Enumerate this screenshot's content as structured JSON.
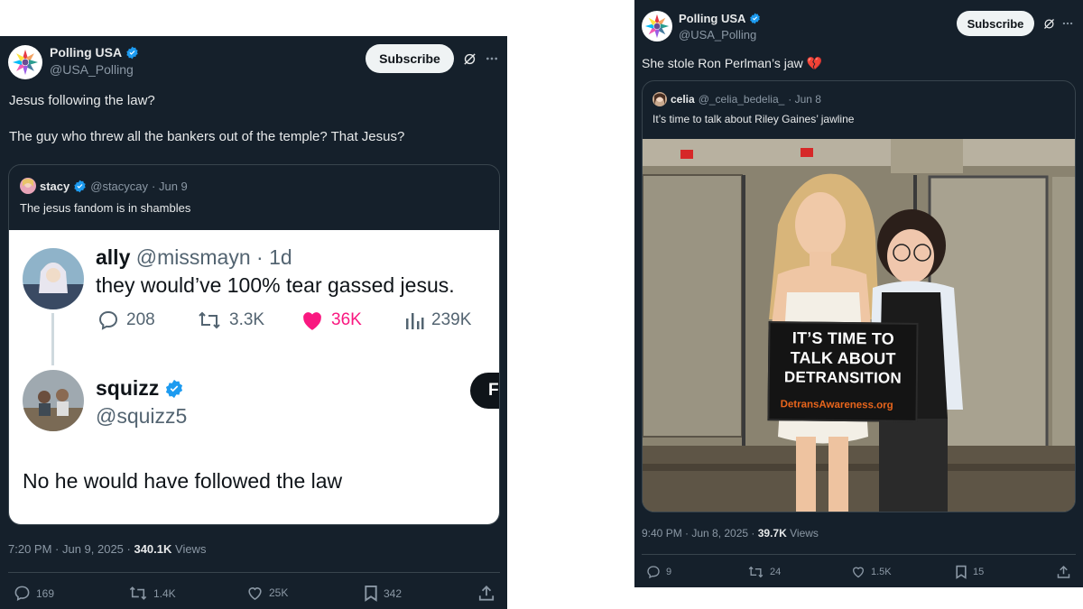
{
  "left_post": {
    "author": {
      "name": "Polling USA",
      "handle": "@USA_Polling"
    },
    "subscribe_label": "Subscribe",
    "text": "Jesus following the law?\n\nThe guy who threw all the bankers out of the temple? That Jesus?",
    "quote": {
      "name": "stacy",
      "handle": "@stacycay",
      "date": "· Jun 9",
      "text": "The jesus fandom is in shambles",
      "screenshot": {
        "first": {
          "name": "ally",
          "handle": "@missmayn",
          "age": "· 1d",
          "text": "they would’ve 100% tear gassed jesus.",
          "stats": {
            "replies": "208",
            "reposts": "3.3K",
            "likes": "36K",
            "views": "239K"
          }
        },
        "second": {
          "name": "squizz",
          "handle": "@squizz5",
          "text": "No he would have followed the law",
          "follow_label": "F"
        }
      }
    },
    "meta": {
      "time": "7:20 PM · Jun 9, 2025 · ",
      "views_count": "340.1K",
      "views_label": " Views"
    },
    "actions": {
      "replies": "169",
      "reposts": "1.4K",
      "likes": "25K",
      "bookmarks": "342"
    }
  },
  "right_post": {
    "author": {
      "name": "Polling USA",
      "handle": "@USA_Polling"
    },
    "subscribe_label": "Subscribe",
    "text": "She stole Ron Perlman’s jaw 💔",
    "quote": {
      "name": "celia",
      "handle": "@_celia_bedelia_",
      "date": "· Jun 8",
      "text": "It’s time to talk about Riley Gaines’ jawline",
      "photo_sign": {
        "line1": "IT’S TIME TO",
        "line2": "TALK ABOUT",
        "line3": "DETRANSITION",
        "url": "DetransAwareness.org"
      }
    },
    "meta": {
      "time": "9:40 PM · Jun 8, 2025 · ",
      "views_count": "39.7K",
      "views_label": " Views"
    },
    "actions": {
      "replies": "9",
      "reposts": "24",
      "likes": "1.5K",
      "bookmarks": "15"
    }
  },
  "colors": {
    "background": "#15202b",
    "border": "#38444d",
    "verified": "#1d9bf0",
    "like_pink": "#f91880",
    "muted": "#8b98a5"
  },
  "icons": [
    "polling-usa-logo-icon",
    "verified-badge-icon",
    "grok-icon",
    "more-icon",
    "reply-icon",
    "repost-icon",
    "like-icon",
    "views-icon",
    "bookmark-icon",
    "share-icon"
  ]
}
